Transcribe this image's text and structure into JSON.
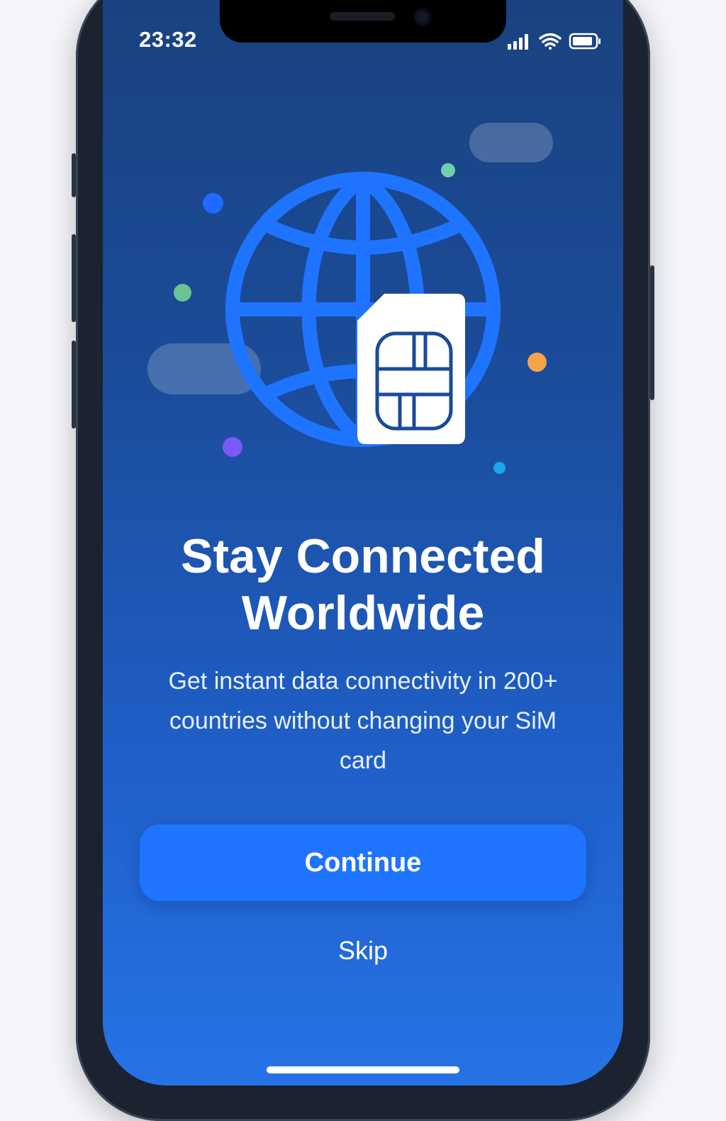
{
  "status_bar": {
    "time": "23:32",
    "icons": [
      "signal-icon",
      "wifi-icon",
      "battery-icon"
    ]
  },
  "hero": {
    "icons": [
      "globe-icon",
      "sim-card-icon"
    ]
  },
  "main": {
    "title": "Stay Connected Worldwide",
    "subtitle": "Get instant data connectivity in 200+ countries without changing your SiM card"
  },
  "actions": {
    "continue_label": "Continue",
    "skip_label": "Skip"
  },
  "colors": {
    "primary": "#1f74ff",
    "background_top": "#1a4280",
    "background_bottom": "#2673e6",
    "globe": "#1f74ff"
  }
}
